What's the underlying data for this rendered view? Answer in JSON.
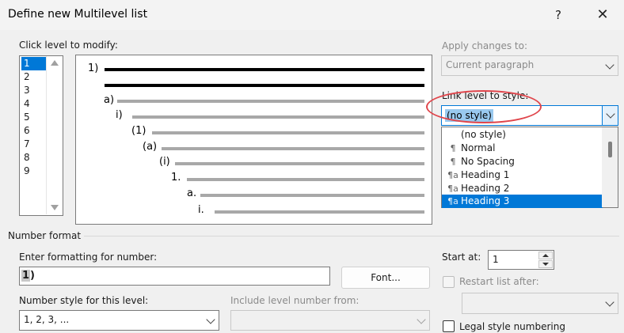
{
  "window": {
    "title": "Define new Multilevel list",
    "help_label": "?",
    "close_label": "✕"
  },
  "levels": {
    "label": "Click level to modify:",
    "items": [
      "1",
      "2",
      "3",
      "4",
      "5",
      "6",
      "7",
      "8",
      "9"
    ],
    "selected": "1"
  },
  "preview": {
    "numbers": [
      "1)",
      "a)",
      "i)",
      "(1)",
      "(a)",
      "(i)",
      "1.",
      "a.",
      "i."
    ]
  },
  "apply": {
    "label": "Apply changes to:",
    "value": "Current paragraph"
  },
  "link_style": {
    "label": "Link level to style:",
    "value": "(no style)",
    "options": [
      {
        "icon": "",
        "label": "(no style)"
      },
      {
        "icon": "¶",
        "label": "Normal"
      },
      {
        "icon": "¶",
        "label": "No Spacing"
      },
      {
        "icon": "¶a",
        "label": "Heading 1"
      },
      {
        "icon": "¶a",
        "label": "Heading 2"
      },
      {
        "icon": "¶a",
        "label": "Heading 3"
      }
    ],
    "highlighted": "Heading 3"
  },
  "number_format": {
    "group_label": "Number format",
    "enter_label": "Enter formatting for number:",
    "format_selected": "1",
    "format_rest": ")",
    "font_button": "Font...",
    "style_label": "Number style for this level:",
    "style_value": "1, 2, 3, ...",
    "include_label": "Include level number from:",
    "include_value": ""
  },
  "start_at": {
    "label": "Start at:",
    "value": "1"
  },
  "restart": {
    "label": "Restart list after:",
    "value": ""
  },
  "legal": {
    "label": "Legal style numbering"
  }
}
